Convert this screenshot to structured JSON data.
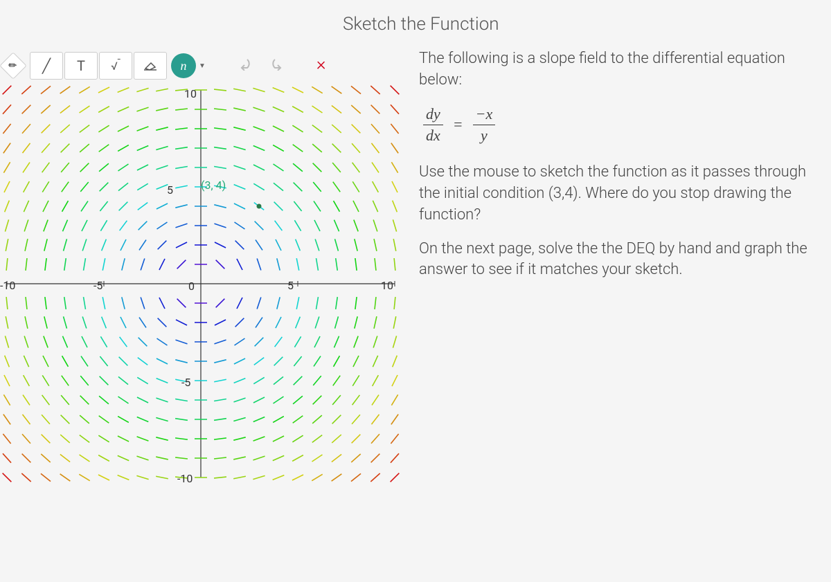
{
  "title": "Sketch the Function",
  "toolbar": {
    "pencil": "✎",
    "text": "T",
    "math_sqrt": "√",
    "eraser": "⌫",
    "math_input": "⋂",
    "undo": "↶",
    "redo": "↷",
    "close": "×"
  },
  "content": {
    "intro": "The following is a slope field to the differential equation below:",
    "eq_dy": "dy",
    "eq_dx": "dx",
    "eq_neg_x": "−x",
    "eq_y": "y",
    "instruction": "Use the mouse to sketch the function as it passes through the initial condition (3,4). Where do you stop drawing the function?",
    "followup": "On the next page, solve the the DEQ by hand and graph the answer to see if it matches your sketch."
  },
  "plot": {
    "point_label": "(3, 4)",
    "axis": {
      "neg10x": "-10",
      "neg5x": "-5",
      "zero": "0",
      "pos5x": "5",
      "pos10x": "10",
      "pos10y": "10",
      "pos5y": "5",
      "neg5y": "-5",
      "neg10y": "-10"
    }
  },
  "chart_data": {
    "type": "slope_field",
    "equation": "dy/dx = -x/y",
    "xlim": [
      -10,
      10
    ],
    "ylim": [
      -10,
      10
    ],
    "xticks": [
      -10,
      -5,
      0,
      5,
      10
    ],
    "yticks": [
      -10,
      -5,
      0,
      5,
      10
    ],
    "grid_step": 1,
    "initial_condition": {
      "x": 3,
      "y": 4,
      "label": "(3, 4)"
    },
    "slope_formula": "−x / y",
    "description": "Slope field for dy/dx = -x/y over [-10,10]×[-10,10] with unit grid spacing. Segment direction at each (x,y) has slope -x/y; slopes tangent to circles centered at origin. A labeled point marks the initial condition (3,4)."
  }
}
